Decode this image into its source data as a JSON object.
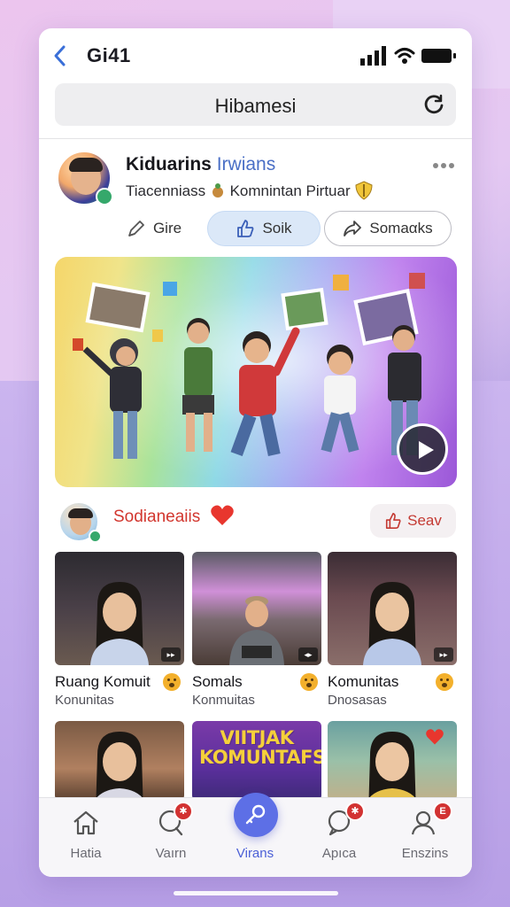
{
  "status_bar": {
    "title": "Gi41"
  },
  "search": {
    "text": "Hibamesi"
  },
  "profile": {
    "name": "Kiduarins",
    "name_accent": "Irwians",
    "subtitle": "Tiacenniass",
    "subtitle_2": "Komnintan Pirtuar"
  },
  "actions": [
    {
      "label": "Gire",
      "icon": "pencil-icon"
    },
    {
      "label": "Soik",
      "icon": "thumbs-up-icon"
    },
    {
      "label": "Somaαks",
      "icon": "share-arrow-icon"
    }
  ],
  "section": {
    "title": "Sodianeaiis",
    "save_label": "Seav"
  },
  "cards": [
    {
      "title": "Ruang Komuit",
      "sub": "Konunitas",
      "badge": "▸▸"
    },
    {
      "title": "Somals",
      "sub": "Konmuitas",
      "badge": "◂▸"
    },
    {
      "title": "Komunitas",
      "sub": "Dnosasas",
      "badge": "▸▸"
    }
  ],
  "promo": {
    "line1": "VIITJAK",
    "line2": "KOMUNTAFS"
  },
  "tabs": [
    {
      "label": "Hatia",
      "icon": "home-icon",
      "badge": ""
    },
    {
      "label": "Vaırn",
      "icon": "chat-icon",
      "badge": "✱"
    },
    {
      "label": "Virans",
      "icon": "key-icon",
      "badge": ""
    },
    {
      "label": "Apıca",
      "icon": "message-icon",
      "badge": "✱"
    },
    {
      "label": "Enszins",
      "icon": "profile-icon",
      "badge": "E"
    }
  ],
  "colors": {
    "accent": "#5d6fe6",
    "section_red": "#d2372f",
    "name_blue": "#4a6fc6",
    "verify_green": "#35a86b"
  }
}
